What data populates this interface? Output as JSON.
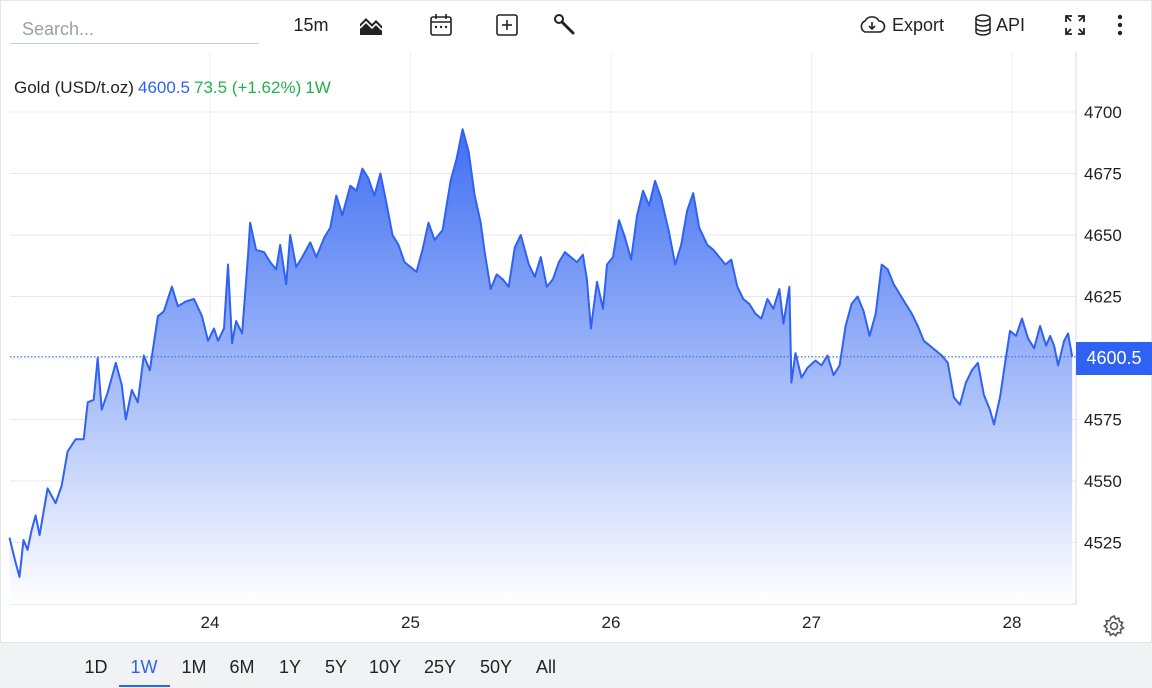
{
  "toolbar": {
    "search_placeholder": "Search...",
    "interval": "15m",
    "export_label": "Export",
    "api_label": "API",
    "icons": [
      "chart-type-icon",
      "calendar-icon",
      "add-indicator-icon",
      "wrench-icon",
      "cloud-download-icon",
      "database-icon",
      "fullscreen-icon",
      "more-vertical-icon"
    ]
  },
  "legend": {
    "symbol": "Gold (USD/t.oz)",
    "price": "4600.5",
    "change": "73.5 (+1.62%)",
    "range": "1W"
  },
  "last_price_tag": "4600.5",
  "periods": [
    "1D",
    "1W",
    "1M",
    "6M",
    "1Y",
    "5Y",
    "10Y",
    "25Y",
    "50Y",
    "All"
  ],
  "active_period": "1W",
  "colors": {
    "line": "#2f62f2",
    "area_top": "#3f6ff2",
    "area_bottom": "#ffffff",
    "up": "#22b14c",
    "accent": "#2f62f2"
  },
  "chart_data": {
    "type": "area",
    "title": "Gold (USD/t.oz)",
    "xlabel": "",
    "ylabel": "",
    "x_ticks": [
      "24",
      "25",
      "26",
      "27",
      "28"
    ],
    "x_tick_days": [
      24,
      25,
      26,
      27,
      28
    ],
    "y_ticks": [
      4525,
      4550,
      4575,
      4600,
      4625,
      4650,
      4675,
      4700
    ],
    "ylim": [
      4500,
      4720
    ],
    "grid": true,
    "last_value": 4600.5,
    "series": [
      {
        "name": "Gold (USD/t.oz)",
        "points": [
          [
            23.0,
            4527
          ],
          [
            23.03,
            4517
          ],
          [
            23.05,
            4511
          ],
          [
            23.07,
            4526
          ],
          [
            23.09,
            4522
          ],
          [
            23.11,
            4530
          ],
          [
            23.13,
            4536
          ],
          [
            23.15,
            4528
          ],
          [
            23.19,
            4547
          ],
          [
            23.23,
            4541
          ],
          [
            23.26,
            4548
          ],
          [
            23.29,
            4562
          ],
          [
            23.33,
            4567
          ],
          [
            23.37,
            4567
          ],
          [
            23.39,
            4582
          ],
          [
            23.42,
            4583
          ],
          [
            23.44,
            4600
          ],
          [
            23.46,
            4579
          ],
          [
            23.49,
            4586
          ],
          [
            23.53,
            4598
          ],
          [
            23.56,
            4589
          ],
          [
            23.58,
            4575
          ],
          [
            23.61,
            4587
          ],
          [
            23.64,
            4582
          ],
          [
            23.67,
            4601
          ],
          [
            23.7,
            4595
          ],
          [
            23.74,
            4617
          ],
          [
            23.77,
            4619
          ],
          [
            23.81,
            4629
          ],
          [
            23.84,
            4621
          ],
          [
            23.88,
            4623
          ],
          [
            23.92,
            4624
          ],
          [
            23.96,
            4617
          ],
          [
            23.99,
            4607
          ],
          [
            24.02,
            4612
          ],
          [
            24.04,
            4607
          ],
          [
            24.07,
            4612
          ],
          [
            24.09,
            4638
          ],
          [
            24.11,
            4606
          ],
          [
            24.13,
            4615
          ],
          [
            24.16,
            4610
          ],
          [
            24.19,
            4642
          ],
          [
            24.2,
            4655
          ],
          [
            24.23,
            4644
          ],
          [
            24.27,
            4643
          ],
          [
            24.3,
            4639
          ],
          [
            24.33,
            4636
          ],
          [
            24.35,
            4646
          ],
          [
            24.38,
            4630
          ],
          [
            24.4,
            4650
          ],
          [
            24.43,
            4637
          ],
          [
            24.46,
            4641
          ],
          [
            24.5,
            4647
          ],
          [
            24.53,
            4641
          ],
          [
            24.57,
            4649
          ],
          [
            24.6,
            4653
          ],
          [
            24.63,
            4666
          ],
          [
            24.66,
            4658
          ],
          [
            24.7,
            4670
          ],
          [
            24.73,
            4668
          ],
          [
            24.76,
            4677
          ],
          [
            24.79,
            4673
          ],
          [
            24.82,
            4666
          ],
          [
            24.85,
            4675
          ],
          [
            24.88,
            4663
          ],
          [
            24.91,
            4650
          ],
          [
            24.94,
            4646
          ],
          [
            24.97,
            4639
          ],
          [
            25.0,
            4637
          ],
          [
            25.03,
            4635
          ],
          [
            25.06,
            4644
          ],
          [
            25.09,
            4655
          ],
          [
            25.12,
            4648
          ],
          [
            25.16,
            4652
          ],
          [
            25.2,
            4672
          ],
          [
            25.23,
            4681
          ],
          [
            25.26,
            4693
          ],
          [
            25.29,
            4684
          ],
          [
            25.32,
            4666
          ],
          [
            25.35,
            4655
          ],
          [
            25.37,
            4643
          ],
          [
            25.4,
            4628
          ],
          [
            25.43,
            4634
          ],
          [
            25.46,
            4632
          ],
          [
            25.49,
            4629
          ],
          [
            25.52,
            4645
          ],
          [
            25.55,
            4650
          ],
          [
            25.59,
            4638
          ],
          [
            25.62,
            4633
          ],
          [
            25.65,
            4641
          ],
          [
            25.68,
            4629
          ],
          [
            25.71,
            4632
          ],
          [
            25.74,
            4639
          ],
          [
            25.77,
            4643
          ],
          [
            25.8,
            4641
          ],
          [
            25.83,
            4639
          ],
          [
            25.86,
            4642
          ],
          [
            25.88,
            4632
          ],
          [
            25.9,
            4612
          ],
          [
            25.93,
            4631
          ],
          [
            25.96,
            4620
          ],
          [
            25.98,
            4638
          ],
          [
            26.01,
            4641
          ],
          [
            26.04,
            4656
          ],
          [
            26.07,
            4649
          ],
          [
            26.1,
            4640
          ],
          [
            26.13,
            4658
          ],
          [
            26.16,
            4668
          ],
          [
            26.19,
            4662
          ],
          [
            26.22,
            4672
          ],
          [
            26.25,
            4665
          ],
          [
            26.29,
            4651
          ],
          [
            26.32,
            4638
          ],
          [
            26.35,
            4646
          ],
          [
            26.38,
            4660
          ],
          [
            26.41,
            4667
          ],
          [
            26.44,
            4653
          ],
          [
            26.48,
            4646
          ],
          [
            26.51,
            4644
          ],
          [
            26.54,
            4641
          ],
          [
            26.57,
            4638
          ],
          [
            26.6,
            4640
          ],
          [
            26.63,
            4629
          ],
          [
            26.66,
            4624
          ],
          [
            26.69,
            4622
          ],
          [
            26.72,
            4618
          ],
          [
            26.75,
            4616
          ],
          [
            26.78,
            4624
          ],
          [
            26.81,
            4620
          ],
          [
            26.84,
            4628
          ],
          [
            26.86,
            4614
          ],
          [
            26.89,
            4629
          ],
          [
            26.9,
            4590
          ],
          [
            26.92,
            4602
          ],
          [
            26.95,
            4592
          ],
          [
            26.98,
            4596
          ],
          [
            27.02,
            4599
          ],
          [
            27.05,
            4597
          ],
          [
            27.08,
            4601
          ],
          [
            27.11,
            4593
          ],
          [
            27.14,
            4597
          ],
          [
            27.17,
            4613
          ],
          [
            27.2,
            4622
          ],
          [
            27.23,
            4625
          ],
          [
            27.26,
            4619
          ],
          [
            27.29,
            4609
          ],
          [
            27.32,
            4618
          ],
          [
            27.35,
            4638
          ],
          [
            27.38,
            4636
          ],
          [
            27.41,
            4630
          ],
          [
            27.44,
            4626
          ],
          [
            27.47,
            4622
          ],
          [
            27.5,
            4618
          ],
          [
            27.53,
            4613
          ],
          [
            27.56,
            4607
          ],
          [
            27.59,
            4605
          ],
          [
            27.62,
            4603
          ],
          [
            27.65,
            4601
          ],
          [
            27.68,
            4598
          ],
          [
            27.71,
            4584
          ],
          [
            27.74,
            4581
          ],
          [
            27.77,
            4590
          ],
          [
            27.8,
            4595
          ],
          [
            27.83,
            4598
          ],
          [
            27.86,
            4585
          ],
          [
            27.89,
            4579
          ],
          [
            27.91,
            4573
          ],
          [
            27.94,
            4584
          ],
          [
            27.96,
            4595
          ],
          [
            27.99,
            4611
          ],
          [
            28.02,
            4609
          ],
          [
            28.05,
            4616
          ],
          [
            28.08,
            4608
          ],
          [
            28.11,
            4604
          ],
          [
            28.14,
            4613
          ],
          [
            28.17,
            4605
          ],
          [
            28.19,
            4609
          ],
          [
            28.21,
            4605
          ],
          [
            28.23,
            4597
          ],
          [
            28.26,
            4607
          ],
          [
            28.28,
            4610
          ],
          [
            28.3,
            4600.5
          ]
        ]
      }
    ]
  }
}
